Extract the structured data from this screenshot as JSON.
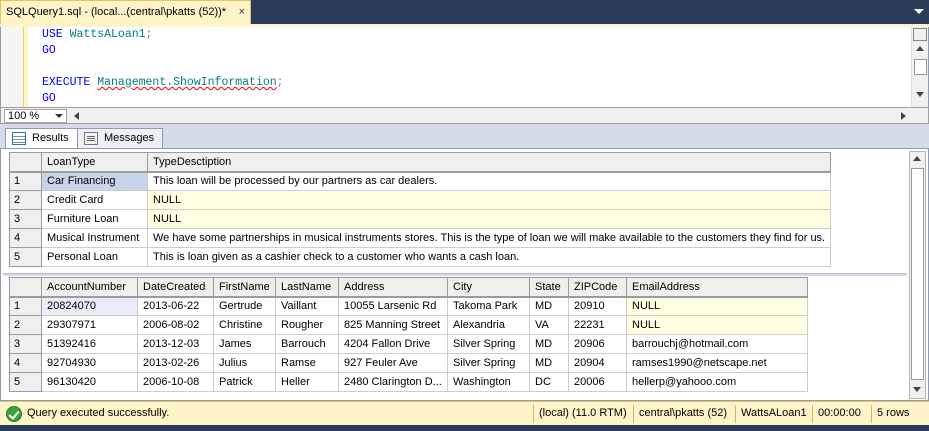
{
  "tab": {
    "title": "SQLQuery1.sql - (local...(central\\pkatts (52))*",
    "close": "×"
  },
  "editor": {
    "line1_kw": "USE",
    "line1_id": "WattsALoan1",
    "line1_end": ";",
    "line2_kw": "GO",
    "line4_kw": "EXECUTE",
    "line4_id": "Management.ShowInformation",
    "line4_end": ";",
    "line5_kw": "GO"
  },
  "zoom": {
    "value": "100 %"
  },
  "result_tabs": {
    "results": "Results",
    "messages": "Messages"
  },
  "grid1": {
    "headers": [
      "LoanType",
      "TypeDesctiption"
    ],
    "rows": [
      {
        "n": "1",
        "c": [
          "Car Financing",
          "This loan will be processed by our partners as car dealers."
        ]
      },
      {
        "n": "2",
        "c": [
          "Credit Card",
          "NULL"
        ]
      },
      {
        "n": "3",
        "c": [
          "Furniture Loan",
          "NULL"
        ]
      },
      {
        "n": "4",
        "c": [
          "Musical Instrument",
          "We have some partnerships in musical instruments stores. This is the type of loan we will make available to the customers they find for us."
        ]
      },
      {
        "n": "5",
        "c": [
          "Personal Loan",
          "This is loan given as a cashier check to a customer who wants a cash loan."
        ]
      }
    ]
  },
  "grid2": {
    "headers": [
      "AccountNumber",
      "DateCreated",
      "FirstName",
      "LastName",
      "Address",
      "City",
      "State",
      "ZIPCode",
      "EmailAddress"
    ],
    "rows": [
      {
        "n": "1",
        "c": [
          "20824070",
          "2013-06-22",
          "Gertrude",
          "Vaillant",
          "10055 Larsenic Rd",
          "Takoma Park",
          "MD",
          "20910",
          "NULL"
        ]
      },
      {
        "n": "2",
        "c": [
          "29307971",
          "2006-08-02",
          "Christine",
          "Rougher",
          "825 Manning Street",
          "Alexandria",
          "VA",
          "22231",
          "NULL"
        ]
      },
      {
        "n": "3",
        "c": [
          "51392416",
          "2013-12-03",
          "James",
          "Barrouch",
          "4204 Fallon Drive",
          "Silver Spring",
          "MD",
          "20906",
          "barrouchj@hotmail.com"
        ]
      },
      {
        "n": "4",
        "c": [
          "92704930",
          "2013-02-26",
          "Julius",
          "Ramse",
          "927 Feuler Ave",
          "Silver Spring",
          "MD",
          "20904",
          "ramses1990@netscape.net"
        ]
      },
      {
        "n": "5",
        "c": [
          "96130420",
          "2006-10-08",
          "Patrick",
          "Heller",
          "2480 Clarington D...",
          "Washington",
          "DC",
          "20006",
          "hellerp@yahooo.com"
        ]
      }
    ]
  },
  "status": {
    "message": "Query executed successfully.",
    "server": "(local) (11.0 RTM)",
    "user": "central\\pkatts (52)",
    "database": "WattsALoan1",
    "time": "00:00:00",
    "rows": "5 rows"
  },
  "colors": {
    "status_bar": "#fff4c8",
    "tabbar": "#2b3c59",
    "keyword": "#0000ff",
    "identifier": "#008080",
    "null_cell": "#ffffe1"
  }
}
